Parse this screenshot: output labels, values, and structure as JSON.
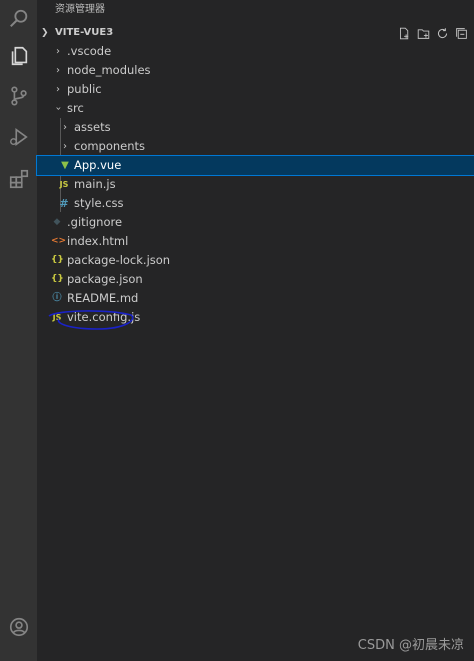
{
  "activity_bar": {
    "icons": [
      "search-icon",
      "explorer-icon",
      "source-control-icon",
      "run-debug-icon",
      "extensions-icon",
      "account-icon"
    ]
  },
  "explorer": {
    "header": "资源管理器",
    "section_title": "VITE-VUE3",
    "actions": [
      "new-file-icon",
      "new-folder-icon",
      "refresh-icon",
      "collapse-all-icon"
    ],
    "items": [
      {
        "label": ".vscode",
        "type": "folder"
      },
      {
        "label": "node_modules",
        "type": "folder"
      },
      {
        "label": "public",
        "type": "folder"
      },
      {
        "label": "src",
        "type": "folder-open"
      },
      {
        "label": "assets",
        "type": "folder"
      },
      {
        "label": "components",
        "type": "folder"
      },
      {
        "label": "App.vue",
        "type": "vue",
        "selected": true
      },
      {
        "label": "main.js",
        "type": "js",
        "icon_text": "JS"
      },
      {
        "label": "style.css",
        "type": "css",
        "icon_text": "#"
      },
      {
        "label": ".gitignore",
        "type": "git",
        "icon_text": "◆"
      },
      {
        "label": "index.html",
        "type": "html",
        "icon_text": "<>"
      },
      {
        "label": "package-lock.json",
        "type": "json",
        "icon_text": "{}"
      },
      {
        "label": "package.json",
        "type": "json",
        "icon_text": "{}"
      },
      {
        "label": "README.md",
        "type": "info",
        "icon_text": "ⓘ"
      },
      {
        "label": "vite.config.js",
        "type": "js",
        "icon_text": "JS"
      }
    ]
  },
  "colors": {
    "activity_bar": "#333333",
    "sidebar": "#252526",
    "selection": "#04395e",
    "selection_border": "#0078d4",
    "annotation": "#1a22c8"
  },
  "watermark": "CSDN @初晨未凉"
}
